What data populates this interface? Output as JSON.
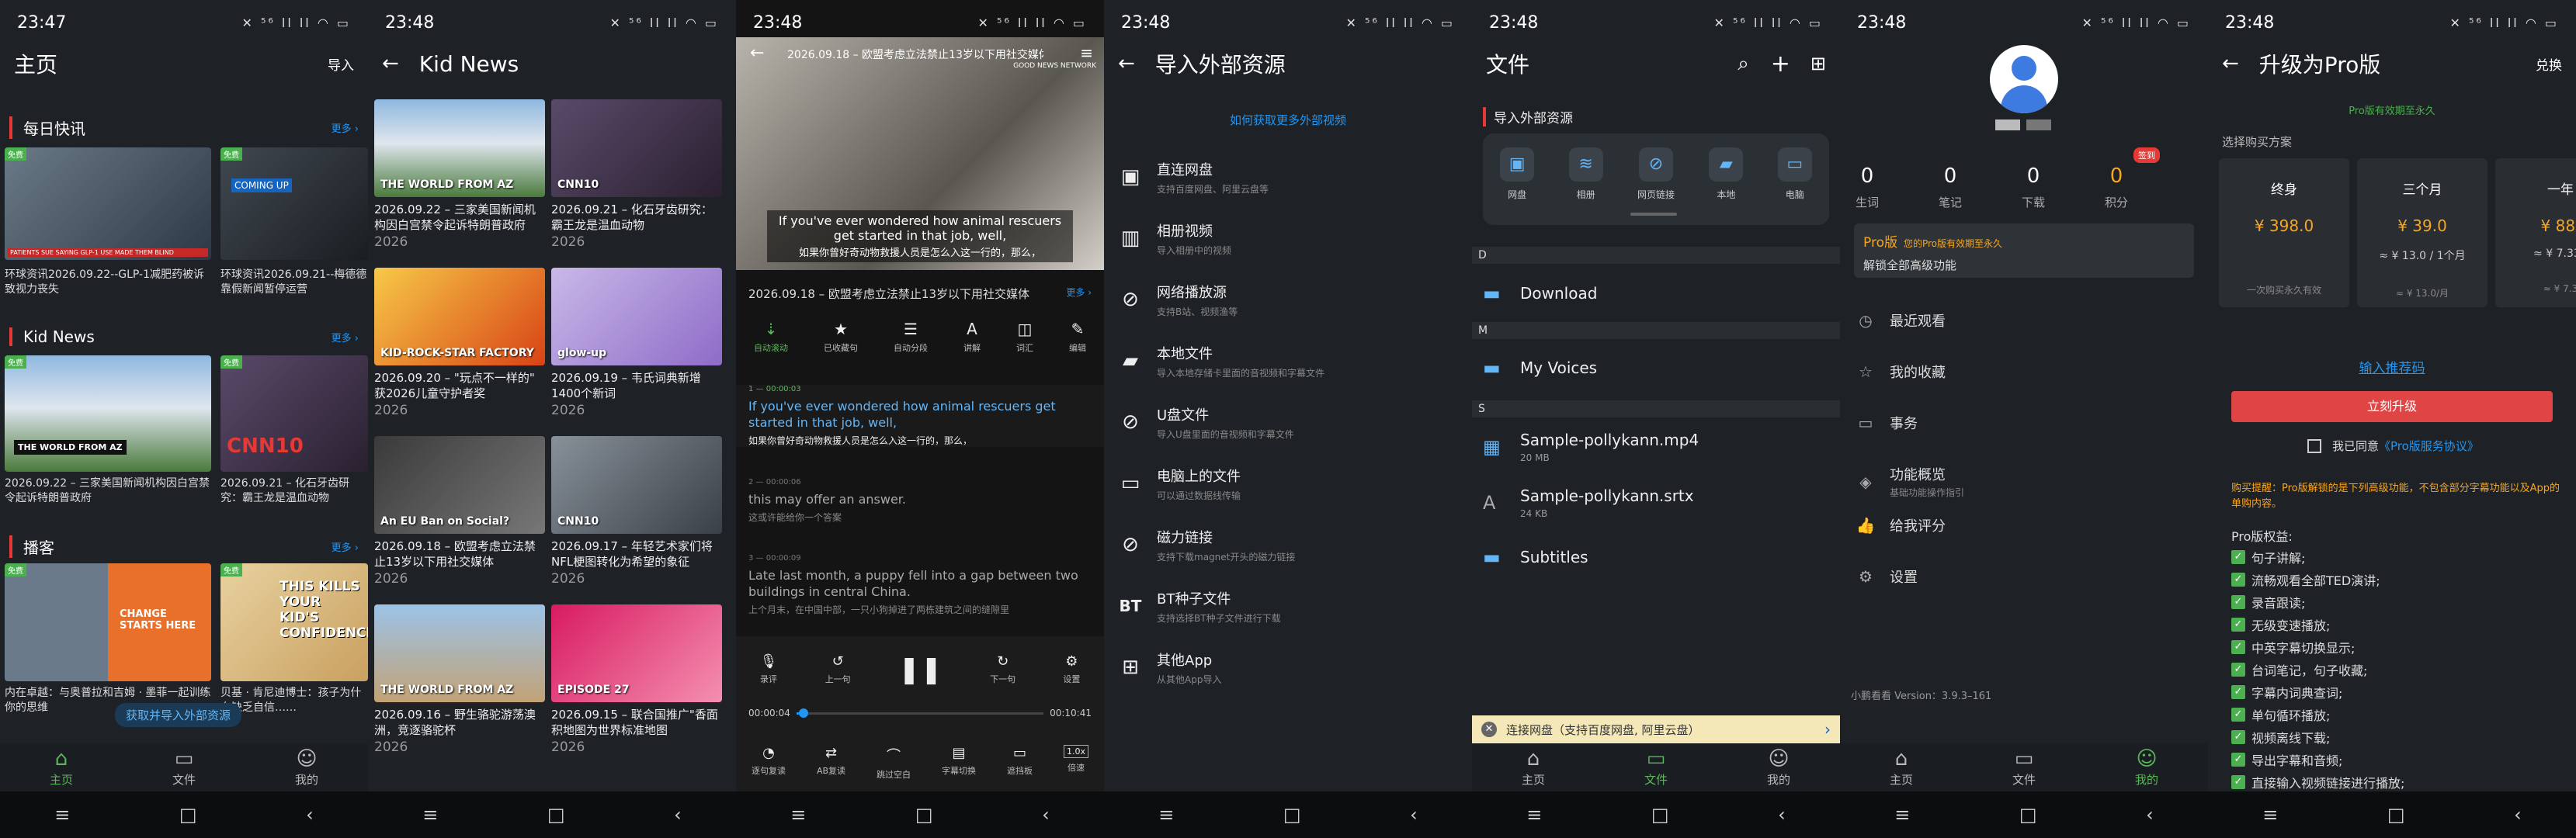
{
  "status": {
    "times": [
      "23:47",
      "23:48",
      "23:48",
      "23:48",
      "23:48",
      "23:48",
      "23:48"
    ],
    "icons": "✕ ⁵⁶ ll ll ◠ ▭"
  },
  "nav": {
    "menu": "≡",
    "home": "□",
    "back": "‹"
  },
  "tabs": {
    "home": "主页",
    "file": "文件",
    "mine": "我的"
  },
  "s1": {
    "title": "主页",
    "import": "导入",
    "sec1": "每日快讯",
    "sec2": "Kid News",
    "sec3": "播客",
    "more": "更多 ›",
    "free": "免费",
    "c1": "环球资讯2026.09.22--GLP-1减肥药被诉致视力丧失",
    "c2": "环球资讯2026.09.21--梅德德靠假新闻暂停运营",
    "c3": "2026.09.22 – 三家美国新闻机构因白宫禁令起诉特朗普政府",
    "c4": "2026.09.21 – 化石牙齿研究：霸王龙是温血动物",
    "c5": "内在卓越：与奥普拉和吉姆 · 墨菲一起训练你的思维",
    "c6": "贝基 · 肯尼迪博士：孩子为什么缺乏自信……",
    "toast": "获取并导入外部资源",
    "img1": "PATIENTS SUE SAYING GLP-1 USE MADE THEM BLIND",
    "img2": "COMING UP",
    "img3": "CHANGE STARTS HERE",
    "img4": "THIS KILLS YOUR KID'S CONFIDENCE",
    "img5": "CNN10",
    "img6": "THE WORLD FROM AZ"
  },
  "s2": {
    "title": "Kid News",
    "cards": [
      {
        "t": "2026.09.22 – 三家美国新闻机构因白宫禁令起诉特朗普政府",
        "y": "2026",
        "img": "THE WORLD FROM AZ"
      },
      {
        "t": "2026.09.21 – 化石牙齿研究：霸王龙是温血动物",
        "y": "2026",
        "img": "CNN10"
      },
      {
        "t": "2026.09.20 – \"玩点不一样的\" 获2026儿童守护者奖",
        "y": "2026",
        "img": "KID-ROCK-STAR FACTORY"
      },
      {
        "t": "2026.09.19 – 韦氏词典新增1400个新词",
        "y": "2026",
        "img": "glow-up"
      },
      {
        "t": "2026.09.18 – 欧盟考虑立法禁止13岁以下用社交媒体",
        "y": "2026",
        "img": "An EU Ban on Social?"
      },
      {
        "t": "2026.09.17 – 年轻艺术家们将NFL梗图转化为希望的象征",
        "y": "2026",
        "img": "CNN10"
      },
      {
        "t": "2026.09.16 – 野生骆驼游荡澳洲，竞逐骆驼杯",
        "y": "2026",
        "img": "THE WORLD FROM AZ"
      },
      {
        "t": "2026.09.15 – 联合国推广\"香面积地图为世界标准地图",
        "y": "2026",
        "img": "EPISODE 27"
      }
    ]
  },
  "s3": {
    "vtitle": "2026.09.18 – 欧盟考虑立法禁止13岁以下用社交媒体",
    "brand": "GOOD NEWS NETWORK",
    "sub_en": "If you've ever wondered how animal rescuers get started in that job, well,",
    "sub_cn": "如果你曾好奇动物救援人员是怎么入这一行的，那么，",
    "tools": [
      "自动滚动",
      "已收藏句",
      "自动分段",
      "讲解",
      "词汇",
      "编辑"
    ],
    "lines": [
      {
        "tm": "1 — 00:00:03",
        "en": "If you've ever wondered how animal rescuers get started in that job, well,",
        "cn": "如果你曾好奇动物救援人员是怎么入这一行的，那么，"
      },
      {
        "tm": "2 — 00:00:06",
        "en": "this may offer an answer.",
        "cn": "这或许能给你一个答案"
      },
      {
        "tm": "3 — 00:00:09",
        "en": "Late last month, a puppy fell into a gap between two buildings in central China.",
        "cn": "上个月末，在中国中部，一只小狗掉进了两栋建筑之间的缝隙里"
      }
    ],
    "ctl": [
      "录评",
      "上一句",
      "",
      "下一句",
      "设置"
    ],
    "t0": "00:00:04",
    "t1": "00:10:41",
    "speed": "1.0x",
    "bot": [
      "逐句复读",
      "AB复读",
      "跳过空白",
      "字幕切换",
      "遮挡板",
      "倍速"
    ]
  },
  "s4": {
    "title": "导入外部资源",
    "link": "如何获取更多外部视频",
    "items": [
      {
        "t": "直连网盘",
        "s": "支持百度网盘、阿里云盘等"
      },
      {
        "t": "相册视频",
        "s": "导入相册中的视频"
      },
      {
        "t": "网络播放源",
        "s": "支持B站、视频渔等"
      },
      {
        "t": "本地文件",
        "s": "导入本地存储卡里面的音视频和字幕文件"
      },
      {
        "t": "U盘文件",
        "s": "导入U盘里面的音视频和字幕文件"
      },
      {
        "t": "电脑上的文件",
        "s": "可以通过数据线传输"
      },
      {
        "t": "磁力链接",
        "s": "支持下载magnet开头的磁力链接"
      },
      {
        "t": "BT种子文件",
        "s": "支持选择BT种子文件进行下载"
      },
      {
        "t": "其他App",
        "s": "从其他App导入"
      }
    ]
  },
  "s5": {
    "title": "文件",
    "sect": "导入外部资源",
    "srcs": [
      "网盘",
      "相册",
      "网页链接",
      "本地",
      "电脑"
    ],
    "idx": [
      "D",
      "M",
      "S"
    ],
    "files": [
      {
        "n": "Download",
        "s": ""
      },
      {
        "n": "My Voices",
        "s": ""
      },
      {
        "n": "Sample-pollykann.mp4",
        "s": "20 MB"
      },
      {
        "n": "Sample-pollykann.srtx",
        "s": "24 KB"
      },
      {
        "n": "Subtitles",
        "s": ""
      }
    ],
    "banner": "连接网盘（支持百度网盘, 阿里云盘）"
  },
  "s6": {
    "stats": [
      {
        "n": "0",
        "l": "生词"
      },
      {
        "n": "0",
        "l": "笔记"
      },
      {
        "n": "0",
        "l": "下载"
      },
      {
        "n": "0",
        "l": "积分"
      }
    ],
    "badge": "签到",
    "pro": "Pro版",
    "pro_note": "您的Pro版有效期至永久",
    "pro_sub": "解锁全部高级功能",
    "menu": [
      "最近观看",
      "我的收藏",
      "事务",
      "功能概览",
      "给我评分",
      "设置"
    ],
    "menu_sub": "基础功能操作指引",
    "ver": "小鹏看看 Version：3.9.3–161"
  },
  "s7": {
    "title": "升级为Pro版",
    "redeem": "兑换",
    "valid": "Pro版有效期至永久",
    "choose": "选择购买方案",
    "plans": [
      {
        "n": "终身",
        "p": "¥ 398.0",
        "q": "",
        "f": "一次购买永久有效"
      },
      {
        "n": "三个月",
        "p": "¥ 39.0",
        "q": "≈ ¥ 13.0 / 1个月",
        "f": "≈ ¥ 13.0/月"
      },
      {
        "n": "一年",
        "p": "¥ 88.",
        "q": "≈ ¥ 7.33 /",
        "f": "≈ ¥ 7.3"
      }
    ],
    "code": "输入推荐码",
    "buy": "立刻升级",
    "agree": "我已同意",
    "terms": "《Pro版服务协议》",
    "tip": "购买提醒：Pro版解锁的是下列高级功能，不包含部分字幕功能以及App的单购内容。",
    "bt": "Pro版权益:",
    "benefits": [
      "句子讲解;",
      "流畅观看全部TED演讲;",
      "录音跟读;",
      "无级变速播放;",
      "中英字幕切换显示;",
      "台词笔记，句子收藏;",
      "字幕内词典查词;",
      "单句循环播放;",
      "视频离线下载;",
      "导出字幕和音频;",
      "直接输入视频链接进行播放;"
    ]
  },
  "colors": {
    "accent": "#5cb85c",
    "red": "#e53935",
    "link": "#2196f3",
    "gold": "#f5a623"
  }
}
